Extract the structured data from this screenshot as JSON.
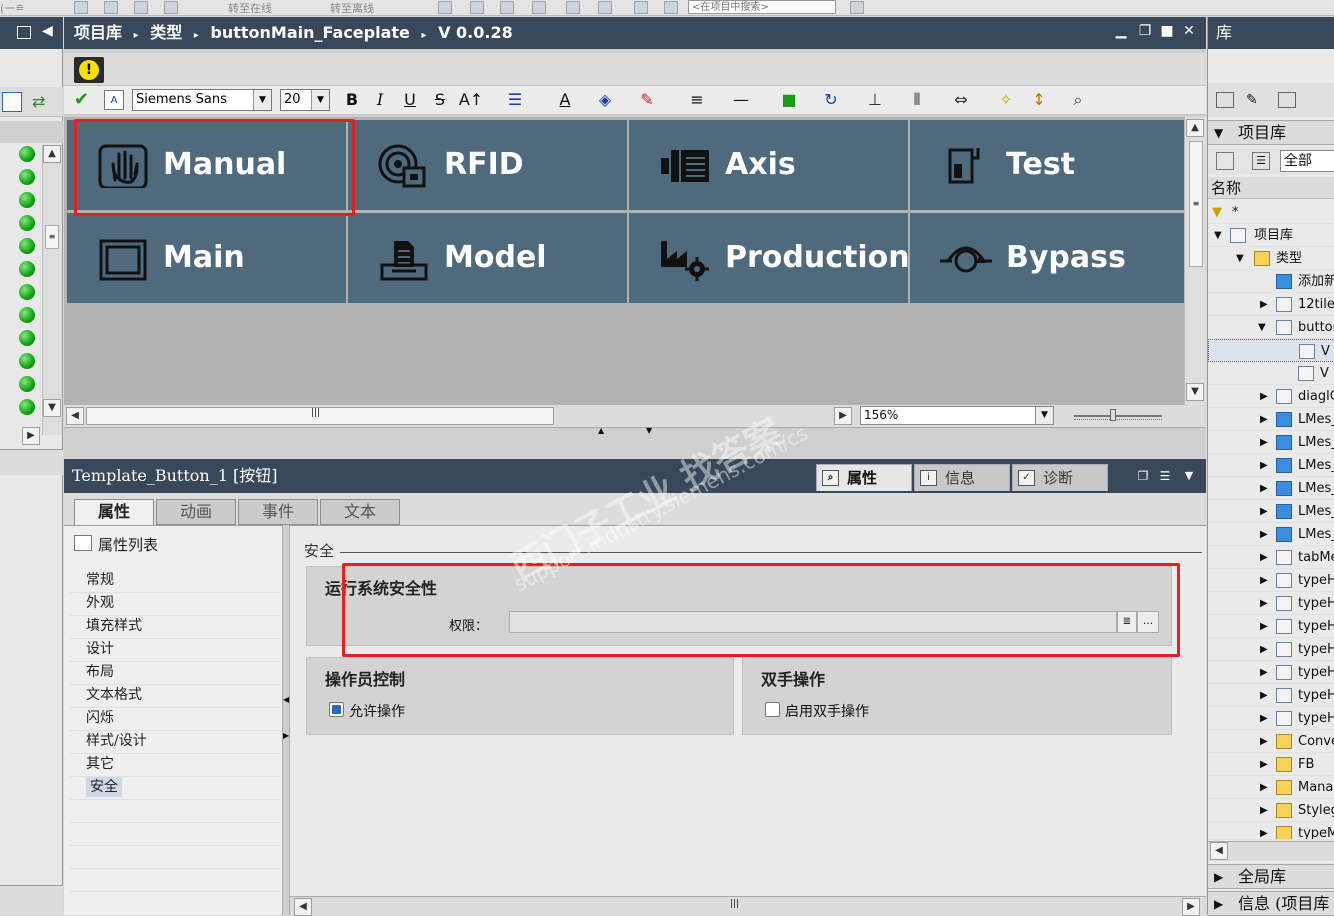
{
  "top_toolbar": {
    "go_online": "转至在线",
    "go_offline": "转至离线",
    "search_placeholder": "<在项目中搜索>"
  },
  "editor": {
    "breadcrumb": [
      "项目库",
      "类型",
      "buttonMain_Faceplate",
      "V 0.0.28"
    ],
    "font_family": "Siemens Sans",
    "font_size": "20",
    "zoom": "156%",
    "tiles": [
      {
        "label": "Manual",
        "icon": "hand-icon"
      },
      {
        "label": "RFID",
        "icon": "rfid-icon"
      },
      {
        "label": "Axis",
        "icon": "axis-icon"
      },
      {
        "label": "Test",
        "icon": "test-icon"
      },
      {
        "label": "Main",
        "icon": "window-icon"
      },
      {
        "label": "Model",
        "icon": "model-icon"
      },
      {
        "label": "Production",
        "icon": "factory-icon"
      },
      {
        "label": "Bypass",
        "icon": "bypass-icon"
      }
    ],
    "tile_color": "#4e6a7c"
  },
  "properties": {
    "title": "Template_Button_1 [按钮]",
    "tabs": [
      "属性",
      "信息",
      "诊断"
    ],
    "subtabs": [
      "属性",
      "动画",
      "事件",
      "文本"
    ],
    "list_header": "属性列表",
    "list_items": [
      "常规",
      "外观",
      "填充样式",
      "设计",
      "布局",
      "文本格式",
      "闪烁",
      "样式/设计",
      "其它",
      "安全"
    ],
    "selected_item": "安全",
    "section": "安全",
    "runtime_security": {
      "title": "运行系统安全性",
      "permission_label": "权限：",
      "permission_value": ""
    },
    "operator_control": {
      "title": "操作员控制",
      "allow_operation": "允许操作",
      "checked": true
    },
    "two_hand": {
      "title": "双手操作",
      "enable_two_hand": "启用双手操作",
      "checked": false
    }
  },
  "library": {
    "title": "库",
    "project_library": "项目库",
    "filter": "全部",
    "name_header": "名称",
    "filter_value": "*",
    "tree": [
      {
        "text": "项目库"
      },
      {
        "text": "类型"
      },
      {
        "text": "添加新"
      },
      {
        "text": "12tile"
      },
      {
        "text": "buttor"
      },
      {
        "text": "V"
      },
      {
        "text": "V"
      },
      {
        "text": "diaglC"
      },
      {
        "text": "LMes_"
      },
      {
        "text": "LMes_"
      },
      {
        "text": "LMes_"
      },
      {
        "text": "LMes_"
      },
      {
        "text": "LMes_"
      },
      {
        "text": "LMes_"
      },
      {
        "text": "tabMe"
      },
      {
        "text": "typeH"
      },
      {
        "text": "typeH"
      },
      {
        "text": "typeH"
      },
      {
        "text": "typeH"
      },
      {
        "text": "typeH"
      },
      {
        "text": "typeH"
      },
      {
        "text": "typeH"
      },
      {
        "text": "Conve"
      },
      {
        "text": "FB"
      },
      {
        "text": "Mana"
      },
      {
        "text": "Styleg"
      },
      {
        "text": "typeM"
      }
    ],
    "global_library": "全局库",
    "info": "信息 (项目库"
  },
  "watermark": {
    "line1": "西门子工业 找答案",
    "line2": "support.industry.siemens.com/cs"
  },
  "colors": {
    "header": "#39475a",
    "highlight": "#e52020"
  }
}
